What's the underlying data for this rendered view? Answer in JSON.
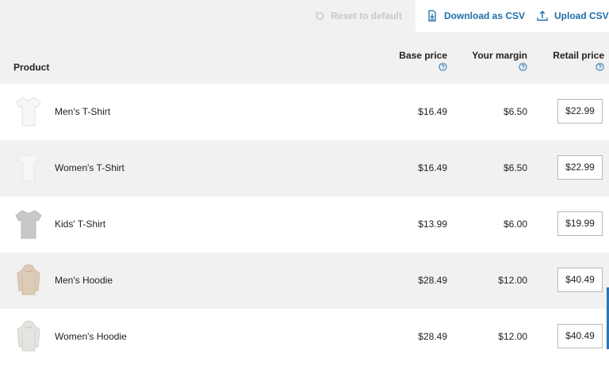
{
  "toolbar": {
    "reset_label": "Reset to default",
    "download_label": "Download as CSV",
    "upload_label": "Upload CSV",
    "icons": {
      "reset": "reset-icon",
      "download": "download-file-icon",
      "upload": "upload-icon"
    }
  },
  "table": {
    "columns": {
      "product": "Product",
      "base_price": "Base price",
      "margin": "Your margin",
      "retail_price": "Retail price",
      "help_icon": "question-circle-icon"
    },
    "rows": [
      {
        "name": "Men's T-Shirt",
        "base_price": "$16.49",
        "margin": "$6.50",
        "retail_price": "$22.99",
        "thumb": "white-tshirt-icon",
        "color": "#f7f7f7"
      },
      {
        "name": "Women's T-Shirt",
        "base_price": "$16.49",
        "margin": "$6.50",
        "retail_price": "$22.99",
        "thumb": "white-tshirt-icon",
        "color": "#f7f7f7"
      },
      {
        "name": "Kids' T-Shirt",
        "base_price": "$13.99",
        "margin": "$6.00",
        "retail_price": "$19.99",
        "thumb": "gray-tshirt-icon",
        "color": "#c8c8c8"
      },
      {
        "name": "Men's Hoodie",
        "base_price": "$28.49",
        "margin": "$12.00",
        "retail_price": "$40.49",
        "thumb": "beige-hoodie-icon",
        "color": "#dccbb7"
      },
      {
        "name": "Women's Hoodie",
        "base_price": "$28.49",
        "margin": "$12.00",
        "retail_price": "$40.49",
        "thumb": "light-hoodie-icon",
        "color": "#e4e4e0"
      }
    ]
  },
  "colors": {
    "accent": "#1d6fa8",
    "muted": "#c7c7c7",
    "row_alt": "#f1f1f1"
  }
}
